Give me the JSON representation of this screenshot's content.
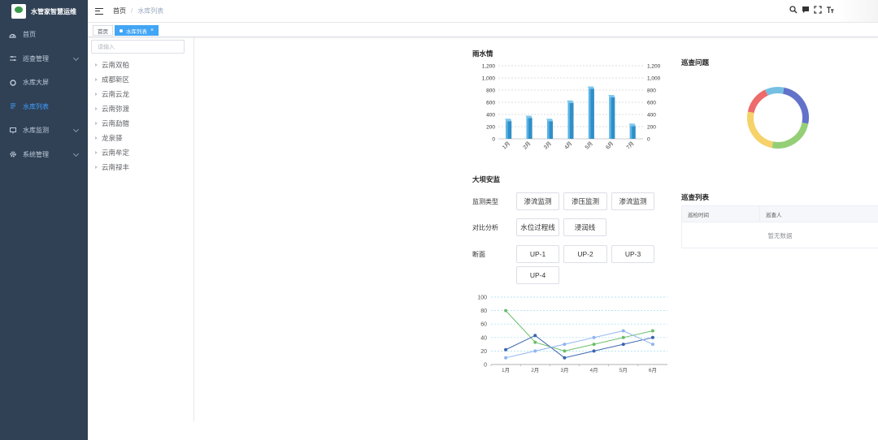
{
  "app": {
    "title": "水管家智慧运维"
  },
  "sidebar": {
    "items": [
      {
        "label": "首页",
        "icon": "dashboard-icon"
      },
      {
        "label": "巡查管理",
        "icon": "sliders-icon",
        "has_children": true
      },
      {
        "label": "水库大屏",
        "icon": "circle-icon"
      },
      {
        "label": "水库列表",
        "icon": "list-icon",
        "active": true
      },
      {
        "label": "水库监测",
        "icon": "monitor-icon",
        "has_children": true
      },
      {
        "label": "系统管理",
        "icon": "gear-icon",
        "has_children": true
      }
    ]
  },
  "breadcrumb": {
    "home": "首页",
    "sep": "/",
    "current": "水库列表"
  },
  "tags": [
    {
      "label": "首页",
      "active": false
    },
    {
      "label": "水库列表",
      "active": true,
      "close": "×"
    }
  ],
  "tree": {
    "search_placeholder": "请输入",
    "items": [
      "云南双柏",
      "成都新区",
      "云南云龙",
      "云南弥渡",
      "云南勐腊",
      "龙泉驿",
      "云南牟定",
      "云南禄丰"
    ]
  },
  "sections": {
    "rain": "雨水情",
    "patrol_issue": "巡查问题",
    "dam": "大坝安监",
    "patrol_list": "巡查列表"
  },
  "dam": {
    "monitor_type_label": "监测类型",
    "monitor_types": [
      "渗流监测",
      "渗压监测",
      "渗流监测"
    ],
    "compare_label": "对比分析",
    "compare_options": [
      "水位过程线",
      "浸润线"
    ],
    "section_label": "断面",
    "sections": [
      "UP-1",
      "UP-2",
      "UP-3",
      "UP-4"
    ]
  },
  "patrol_table": {
    "columns": [
      "巡检时间",
      "巡查人"
    ],
    "empty_text": "暂无数据"
  },
  "chart_data": [
    {
      "type": "bar",
      "title": "雨水情",
      "categories": [
        "1月",
        "2月",
        "3月",
        "4月",
        "5月",
        "6月",
        "7月"
      ],
      "values": [
        290,
        340,
        290,
        590,
        820,
        680,
        210
      ],
      "ylim": [
        0,
        1200
      ],
      "yticks": [
        "0",
        "200",
        "400",
        "600",
        "800",
        "1,000",
        "1,200"
      ],
      "y2ticks": [
        "0",
        "200",
        "400",
        "600",
        "800",
        "1,000",
        "1,200"
      ],
      "grid": true,
      "color": "#2f8fc8"
    },
    {
      "type": "pie",
      "title": "巡查问题",
      "donut": true,
      "values": [
        25,
        25,
        25,
        15,
        10
      ],
      "colors": [
        "#6272c9",
        "#94cf76",
        "#f6d26a",
        "#ee6b6b",
        "#75bfe3"
      ]
    },
    {
      "type": "line",
      "categories": [
        "1月",
        "2月",
        "3月",
        "4月",
        "5月",
        "6月"
      ],
      "ylim": [
        0,
        100
      ],
      "yticks": [
        "0",
        "20",
        "40",
        "60",
        "80",
        "100"
      ],
      "grid": true,
      "series": [
        {
          "values": [
            80,
            33,
            20,
            30,
            40,
            50
          ],
          "color": "#6abf69"
        },
        {
          "values": [
            22,
            43,
            10,
            20,
            30,
            40
          ],
          "color": "#3b64b0"
        },
        {
          "values": [
            10,
            20,
            30,
            40,
            50,
            30
          ],
          "color": "#8fb4f2"
        }
      ]
    }
  ]
}
